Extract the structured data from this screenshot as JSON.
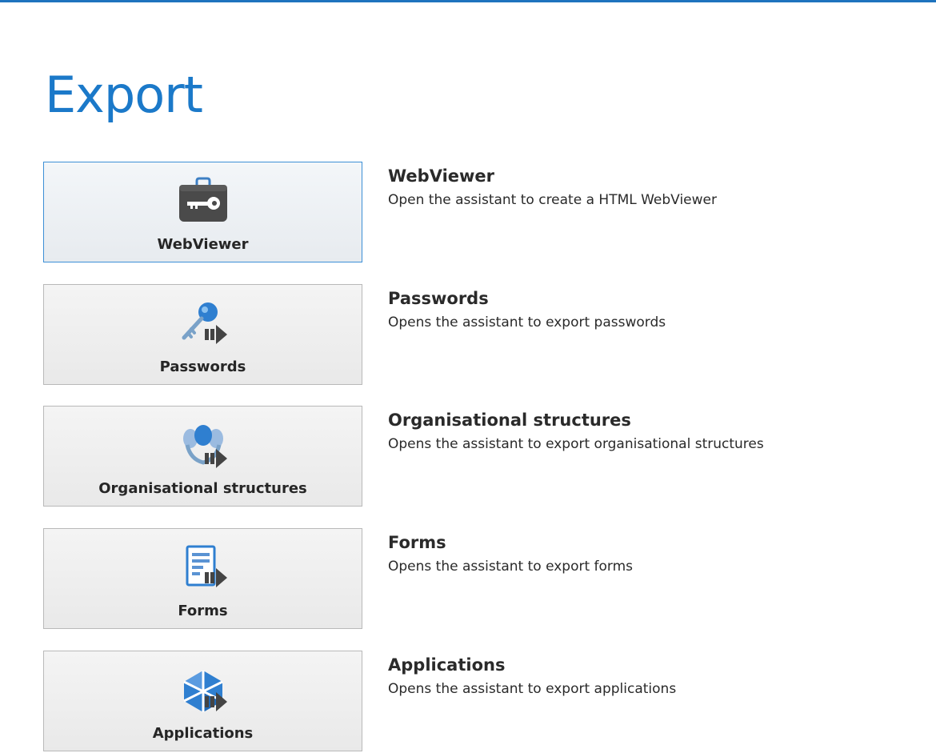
{
  "page": {
    "title": "Export"
  },
  "items": [
    {
      "tile_label": "WebViewer",
      "heading": "WebViewer",
      "description": "Open the assistant to create a HTML WebViewer",
      "icon": "briefcase-key-icon"
    },
    {
      "tile_label": "Passwords",
      "heading": "Passwords",
      "description": "Opens the assistant to export passwords",
      "icon": "key-export-icon"
    },
    {
      "tile_label": "Organisational structures",
      "heading": "Organisational structures",
      "description": "Opens the assistant to export organisational structures",
      "icon": "people-export-icon"
    },
    {
      "tile_label": "Forms",
      "heading": "Forms",
      "description": "Opens the assistant to export forms",
      "icon": "form-export-icon"
    },
    {
      "tile_label": "Applications",
      "heading": "Applications",
      "description": "Opens the assistant to export applications",
      "icon": "application-export-icon"
    }
  ],
  "colors": {
    "accent": "#1b79c9",
    "selected_border": "#3c8fd6",
    "tile_border": "#b9b9b9"
  }
}
